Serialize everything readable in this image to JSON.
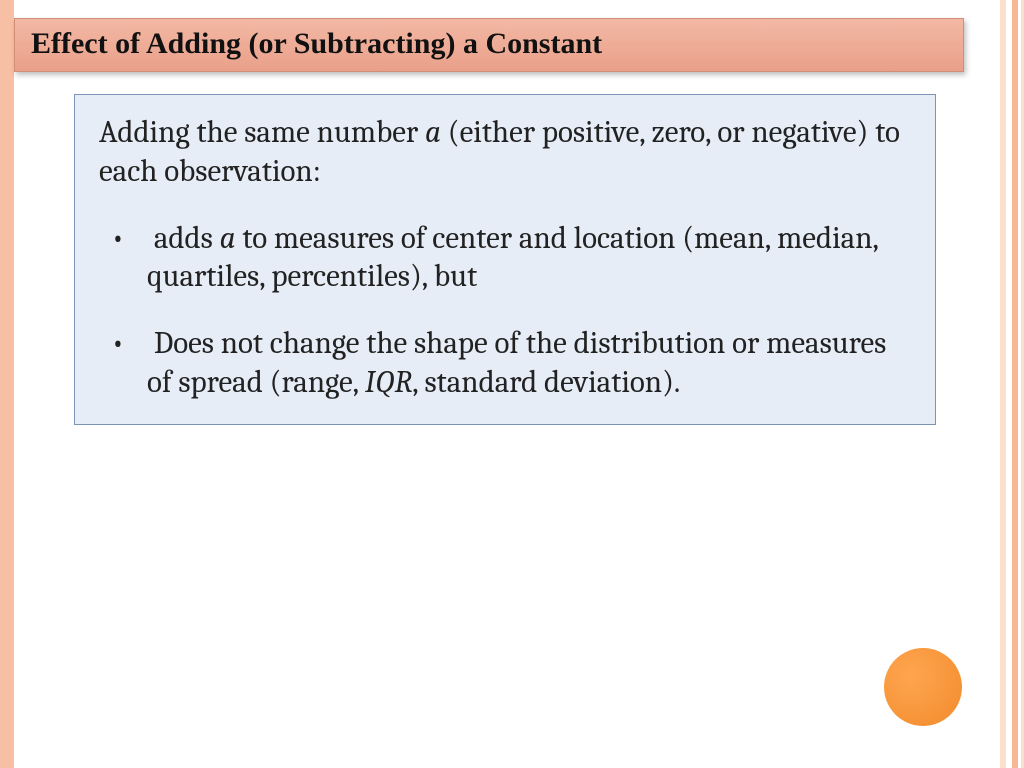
{
  "title": "Effect of Adding (or Subtracting) a Constant",
  "content": {
    "intro_a": "Adding the same number ",
    "intro_var": "a",
    "intro_b": " (either positive, zero, or negative) to each observation:",
    "b1_a": "adds ",
    "b1_var": "a",
    "b1_b": " to measures of center and location (mean, median, quartiles, percentiles), but",
    "b2_a": "Does not change the shape of the distribution or measures of spread (range, ",
    "b2_var": "IQR",
    "b2_b": ", standard deviation)."
  }
}
